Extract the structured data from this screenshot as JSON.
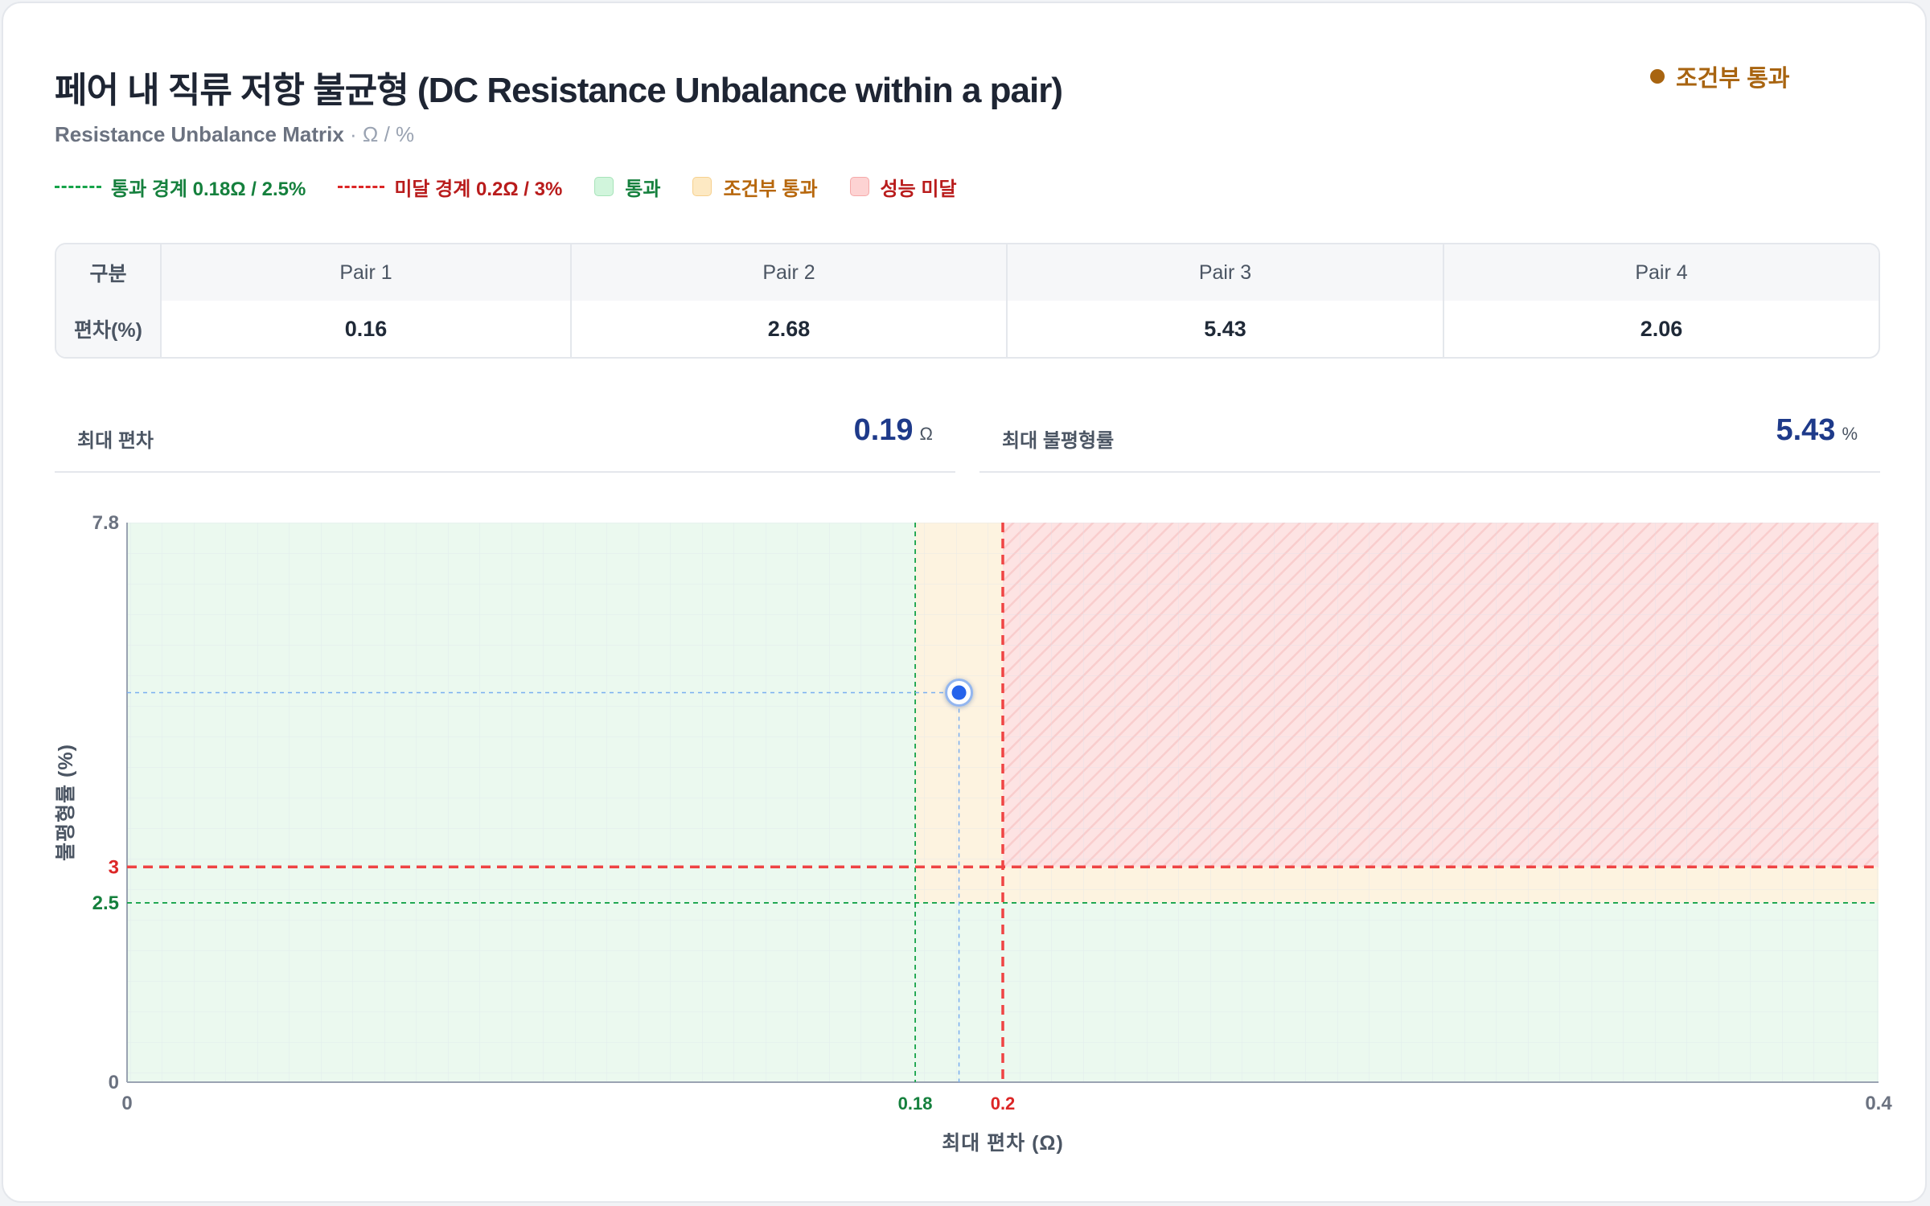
{
  "header": {
    "title": "페어 내 직류 저항 불균형 (DC Resistance Unbalance within a pair)",
    "subtitle_main": "Resistance Unbalance Matrix",
    "subtitle_units": " · Ω / %",
    "status_label": "조건부 통과"
  },
  "legend": {
    "pass_line": "통과 경계 0.18Ω / 2.5%",
    "fail_line": "미달 경계 0.2Ω / 3%",
    "pass_zone": "통과",
    "conditional_zone": "조건부 통과",
    "fail_zone": "성능 미달"
  },
  "table": {
    "corner": "구분",
    "headers": [
      "Pair 1",
      "Pair 2",
      "Pair 3",
      "Pair 4"
    ],
    "row_label": "편차(%)",
    "values": [
      "0.16",
      "2.68",
      "5.43",
      "2.06"
    ]
  },
  "stats": {
    "max_deviation": {
      "label": "최대 편차",
      "value": "0.19",
      "unit": "Ω"
    },
    "max_unbalance": {
      "label": "최대 불평형률",
      "value": "5.43",
      "unit": "%"
    }
  },
  "colors": {
    "pass": "#16a34a",
    "fail": "#dc2626",
    "conditional": "#a86410",
    "point": "#2563eb",
    "stat_value": "#1e3a8a"
  },
  "chart_data": {
    "type": "scatter",
    "xlabel": "최대 편차 (Ω)",
    "ylabel": "불평형률 (%)",
    "xlim": [
      0,
      0.4
    ],
    "ylim": [
      0,
      7.8
    ],
    "x_ticks": [
      0,
      0.4
    ],
    "y_ticks": [
      0,
      7.8
    ],
    "thresholds": {
      "pass_x": 0.18,
      "pass_y": 2.5,
      "fail_x": 0.2,
      "fail_y": 3,
      "pass_x_label": "0.18",
      "pass_y_label": "2.5",
      "fail_x_label": "0.2",
      "fail_y_label": "3"
    },
    "points": [
      {
        "x": 0.19,
        "y": 5.43
      }
    ],
    "grid": true
  }
}
